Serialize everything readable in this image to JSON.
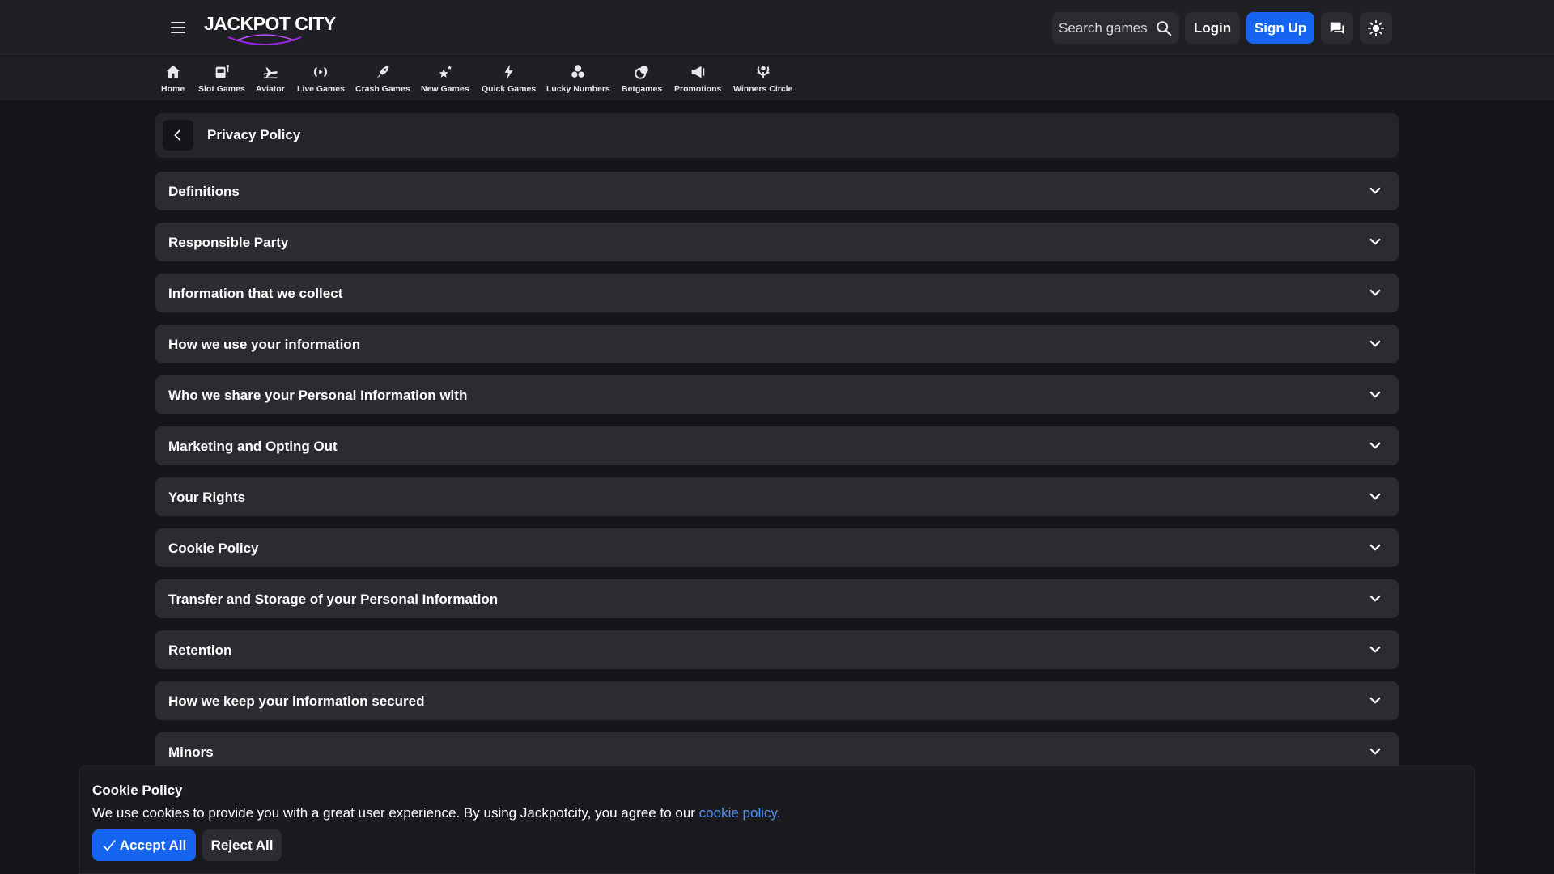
{
  "header": {
    "logo_text": "JACKPOT CITY",
    "search_placeholder": "Search games",
    "login_label": "Login",
    "signup_label": "Sign Up",
    "accent_color": "#1565f0"
  },
  "nav": {
    "items": [
      {
        "label": "Home",
        "icon": "home-icon"
      },
      {
        "label": "Slot Games",
        "icon": "slot-machine-icon"
      },
      {
        "label": "Aviator",
        "icon": "plane-icon"
      },
      {
        "label": "Live Games",
        "icon": "live-broadcast-icon"
      },
      {
        "label": "Crash Games",
        "icon": "rocket-icon"
      },
      {
        "label": "New Games",
        "icon": "stars-icon"
      },
      {
        "label": "Quick Games",
        "icon": "lightning-icon"
      },
      {
        "label": "Lucky Numbers",
        "icon": "lottery-balls-icon"
      },
      {
        "label": "Betgames",
        "icon": "coins-icon"
      },
      {
        "label": "Promotions",
        "icon": "megaphone-icon"
      },
      {
        "label": "Winners Circle",
        "icon": "laurel-icon"
      }
    ]
  },
  "page": {
    "title": "Privacy Policy"
  },
  "sections": [
    {
      "title": "Definitions"
    },
    {
      "title": "Responsible Party"
    },
    {
      "title": "Information that we collect"
    },
    {
      "title": "How we use your information"
    },
    {
      "title": "Who we share your Personal Information with"
    },
    {
      "title": "Marketing and Opting Out"
    },
    {
      "title": "Your Rights"
    },
    {
      "title": "Cookie Policy"
    },
    {
      "title": "Transfer and Storage of your Personal Information"
    },
    {
      "title": "Retention"
    },
    {
      "title": "How we keep your information secured"
    },
    {
      "title": "Minors"
    }
  ],
  "cookie_banner": {
    "title": "Cookie Policy",
    "text": "We use cookies to provide you with a great user experience. By using Jackpotcity, you agree to our ",
    "link_text": "cookie policy.",
    "accept_label": "Accept All",
    "reject_label": "Reject All"
  }
}
